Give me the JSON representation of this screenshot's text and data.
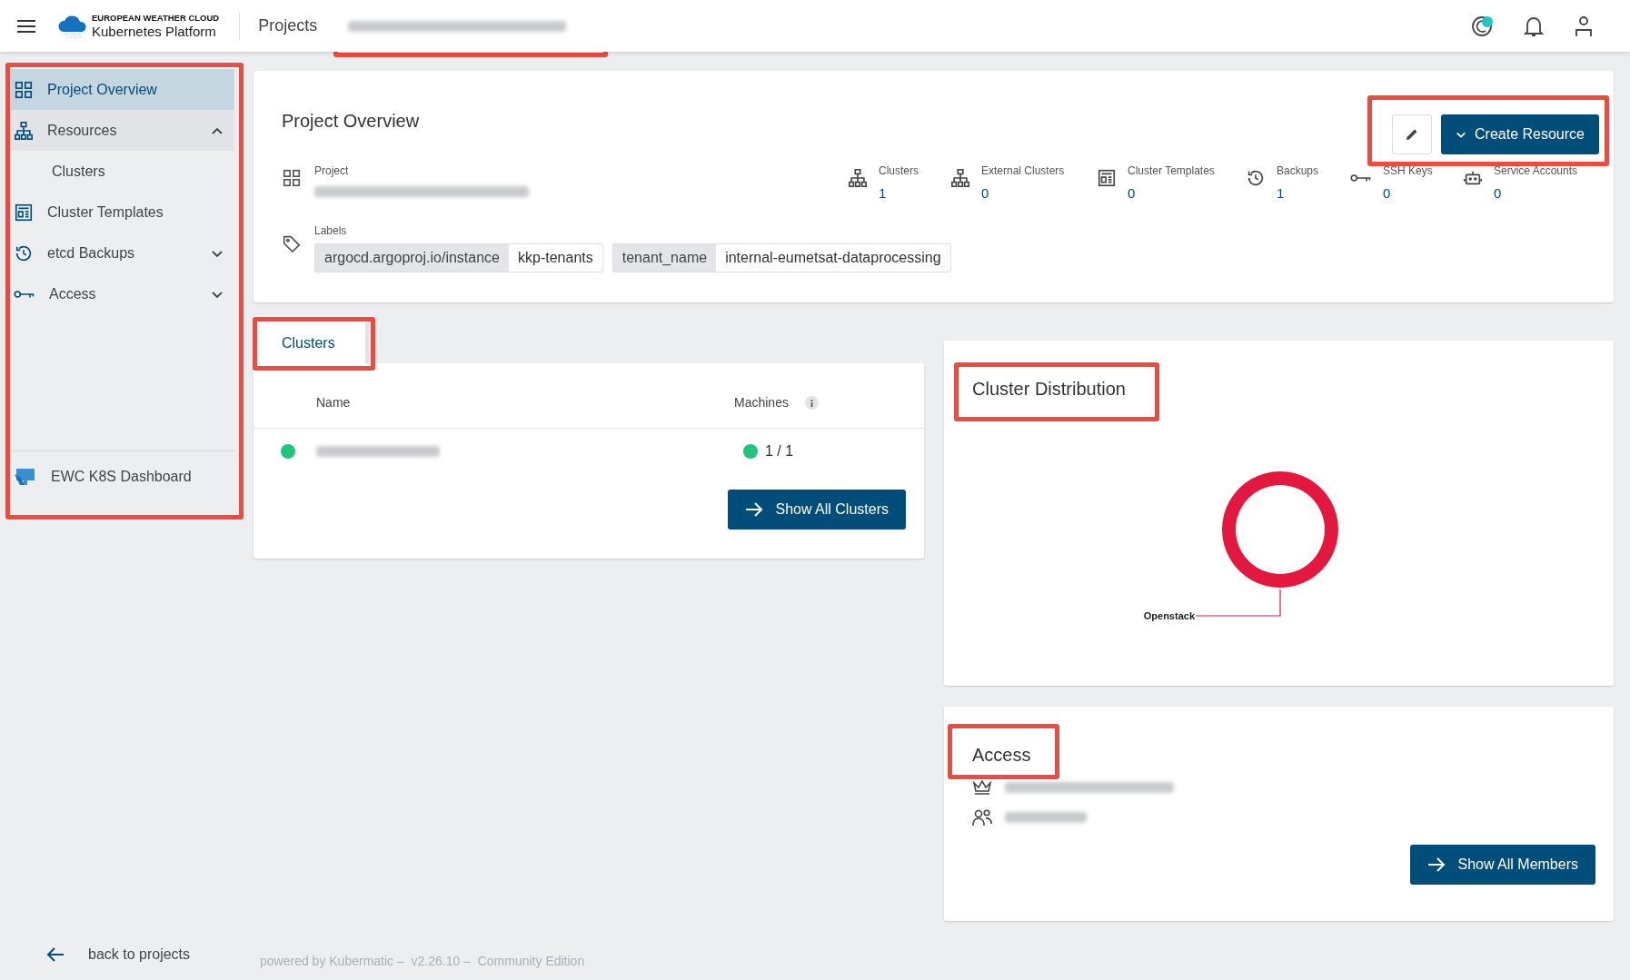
{
  "header": {
    "brand_top": "EUROPEAN WEATHER CLOUD",
    "brand_bottom": "Kubernetes Platform",
    "section": "Projects",
    "notification_dot": true
  },
  "sidebar": {
    "items": [
      {
        "label": "Project Overview",
        "selected": true
      },
      {
        "label": "Resources",
        "selected": false,
        "expanded": true,
        "children": [
          {
            "label": "Clusters",
            "selected": false
          }
        ]
      },
      {
        "label": "Cluster Templates",
        "selected": false
      },
      {
        "label": "etcd Backups",
        "selected": false,
        "expanded": false
      },
      {
        "label": "Access",
        "selected": false,
        "expanded": false
      }
    ],
    "bottom_item": "EWC K8S Dashboard",
    "back_link": "back to projects"
  },
  "overview": {
    "title": "Project Overview",
    "create_button": "Create Resource",
    "project_label": "Project",
    "stats": [
      {
        "label": "Clusters",
        "value": "1"
      },
      {
        "label": "External Clusters",
        "value": "0"
      },
      {
        "label": "Cluster Templates",
        "value": "0"
      },
      {
        "label": "Backups",
        "value": "1"
      },
      {
        "label": "SSH Keys",
        "value": "0"
      },
      {
        "label": "Service Accounts",
        "value": "0"
      }
    ],
    "labels_title": "Labels",
    "labels": [
      {
        "key": "argocd.argoproj.io/instance",
        "value": "kkp-tenants"
      },
      {
        "key": "tenant_name",
        "value": "internal-eumetsat-dataprocessing"
      }
    ]
  },
  "clusters": {
    "tab": "Clusters",
    "columns": [
      "Name",
      "Machines"
    ],
    "rows": [
      {
        "color": "#22c47c",
        "machines": {
          "text": "1 / 1",
          "color": "#22c47c"
        }
      }
    ],
    "button": "Show All Clusters"
  },
  "distribution": {
    "chart_data": {
      "type": "donut",
      "title": "Cluster Distribution",
      "categories": [
        "Openstack"
      ]
    }
  },
  "access": {
    "title": "Access",
    "button": "Show All Members"
  },
  "footer": "powered by Kubermatic –  v2.26.10 –  Community Edition"
}
